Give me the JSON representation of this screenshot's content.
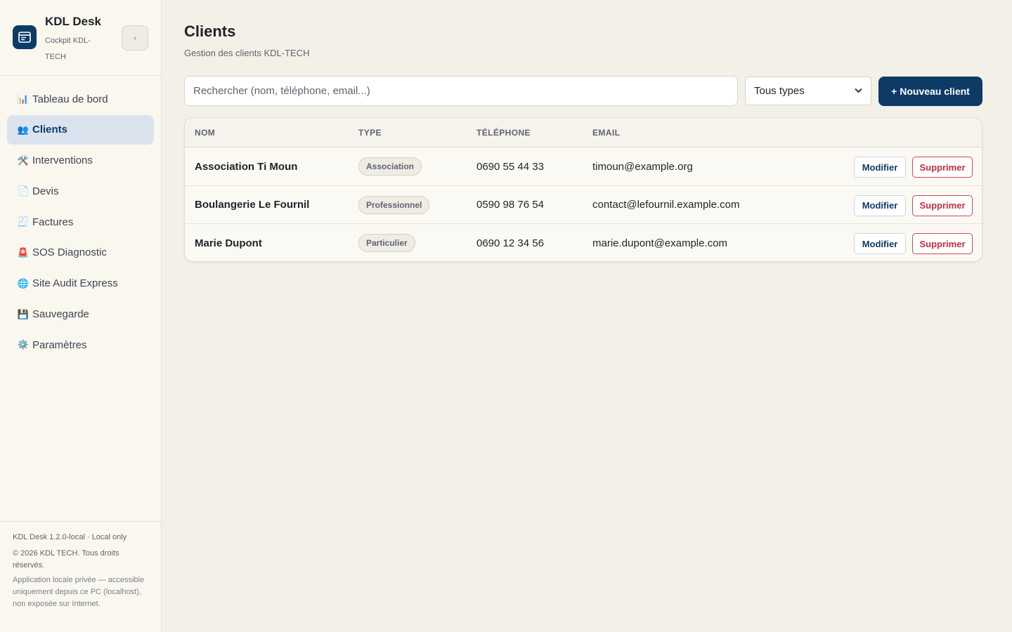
{
  "app": {
    "name": "KDL Desk",
    "subtitle": "Cockpit KDL-TECH",
    "collapse_label": "‹"
  },
  "sidebar": {
    "items": [
      {
        "icon": "📊",
        "icon_name": "chart-icon",
        "label": "Tableau de bord",
        "active": false
      },
      {
        "icon": "👥",
        "icon_name": "users-icon",
        "label": "Clients",
        "active": true
      },
      {
        "icon": "🛠️",
        "icon_name": "tools-icon",
        "label": "Interventions",
        "active": false
      },
      {
        "icon": "📄",
        "icon_name": "document-icon",
        "label": "Devis",
        "active": false
      },
      {
        "icon": "🧾",
        "icon_name": "receipt-icon",
        "label": "Factures",
        "active": false
      },
      {
        "icon": "🚨",
        "icon_name": "siren-icon",
        "label": "SOS Diagnostic",
        "active": false
      },
      {
        "icon": "🌐",
        "icon_name": "globe-icon",
        "label": "Site Audit Express",
        "active": false
      },
      {
        "icon": "💾",
        "icon_name": "floppy-icon",
        "label": "Sauvegarde",
        "active": false
      },
      {
        "icon": "⚙️",
        "icon_name": "gear-icon",
        "label": "Paramètres",
        "active": false
      }
    ],
    "footer": {
      "version": "KDL Desk 1.2.0-local · Local only",
      "copyright": "© 2026 KDL TECH. Tous droits réservés.",
      "notice": "Application locale privée — accessible uniquement depuis ce PC (localhost), non exposée sur Internet."
    }
  },
  "page": {
    "title": "Clients",
    "subtitle": "Gestion des clients KDL-TECH"
  },
  "toolbar": {
    "search_placeholder": "Rechercher (nom, téléphone, email...)",
    "search_value": "",
    "type_filter_value": "Tous types",
    "new_button_label": "+ Nouveau client"
  },
  "table": {
    "columns": [
      "NOM",
      "TYPE",
      "TÉLÉPHONE",
      "EMAIL"
    ],
    "rows": [
      {
        "name": "Association Ti Moun",
        "type": "Association",
        "phone": "0690 55 44 33",
        "email": "timoun@example.org"
      },
      {
        "name": "Boulangerie Le Fournil",
        "type": "Professionnel",
        "phone": "0590 98 76 54",
        "email": "contact@lefournil.example.com"
      },
      {
        "name": "Marie Dupont",
        "type": "Particulier",
        "phone": "0690 12 34 56",
        "email": "marie.dupont@example.com"
      }
    ],
    "edit_label": "Modifier",
    "delete_label": "Supprimer"
  },
  "colors": {
    "primary": "#0d3b66",
    "danger": "#c0303f",
    "background": "#f3f0e8",
    "sidebar_bg": "#faf7ef",
    "active_nav_bg": "#dbe4ee"
  }
}
